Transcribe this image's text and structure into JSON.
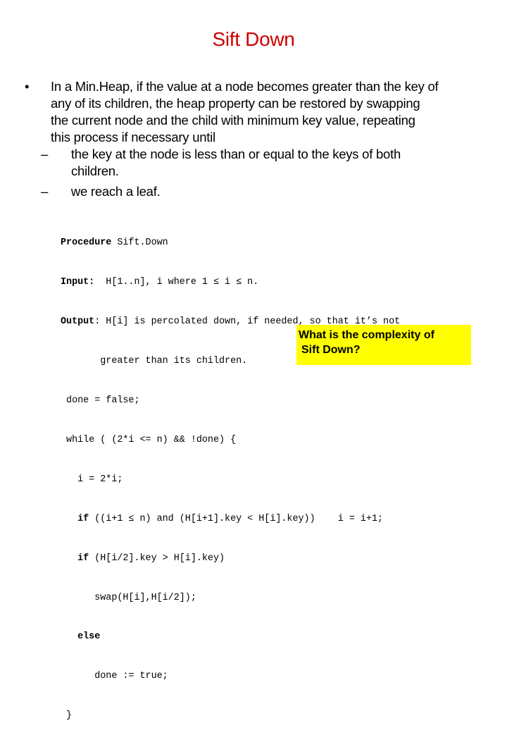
{
  "slide": {
    "title": "Sift Down",
    "colors": {
      "title": "#cc0000",
      "callout_bg": "#ffff00",
      "text": "#000000"
    }
  },
  "bullets": [
    {
      "marker": "•",
      "lines": [
        "In a Min.Heap, if the value at a node becomes greater than the key of",
        "any of its children, the heap property can be restored by swapping",
        "the current node and the child with minimum key value, repeating",
        "this process if necessary until"
      ],
      "sub_bullets": [
        {
          "marker": "–",
          "lines": [
            " the key at the node is less than or equal to the keys of both",
            "children."
          ]
        },
        {
          "marker": "–",
          "lines": [
            " we reach a leaf."
          ]
        }
      ]
    }
  ],
  "code": {
    "procedure_kw": "Procedure",
    "procedure_name": " Sift.Down",
    "input_kw": "Input:",
    "input_text": "  H[1..n], i where 1 ≤ i ≤ n.",
    "output_kw": "Output",
    "output_text": ": H[i] is percolated down, if needed, so that it’s not",
    "output_cont": "       greater than its children.",
    "lines": [
      " done = false;",
      " while ( (2*i <= n) && !done) {",
      "   i = 2*i;"
    ],
    "if1_indent": "   ",
    "if1_kw": "if",
    "if1_text": " ((i+1 ≤ n) and (H[i+1].key < H[i].key))    i = i+1;",
    "if2_indent": "   ",
    "if2_kw": "if",
    "if2_text": " (H[i/2].key > H[i].key)",
    "swap_line": "      swap(H[i],H[i/2]);",
    "else_indent": "   ",
    "else_kw": "else",
    "done_line": "      done := true;",
    "close_brace": " }"
  },
  "callout": {
    "line1": "What is the complexity of",
    "line2": "Sift Down?"
  }
}
